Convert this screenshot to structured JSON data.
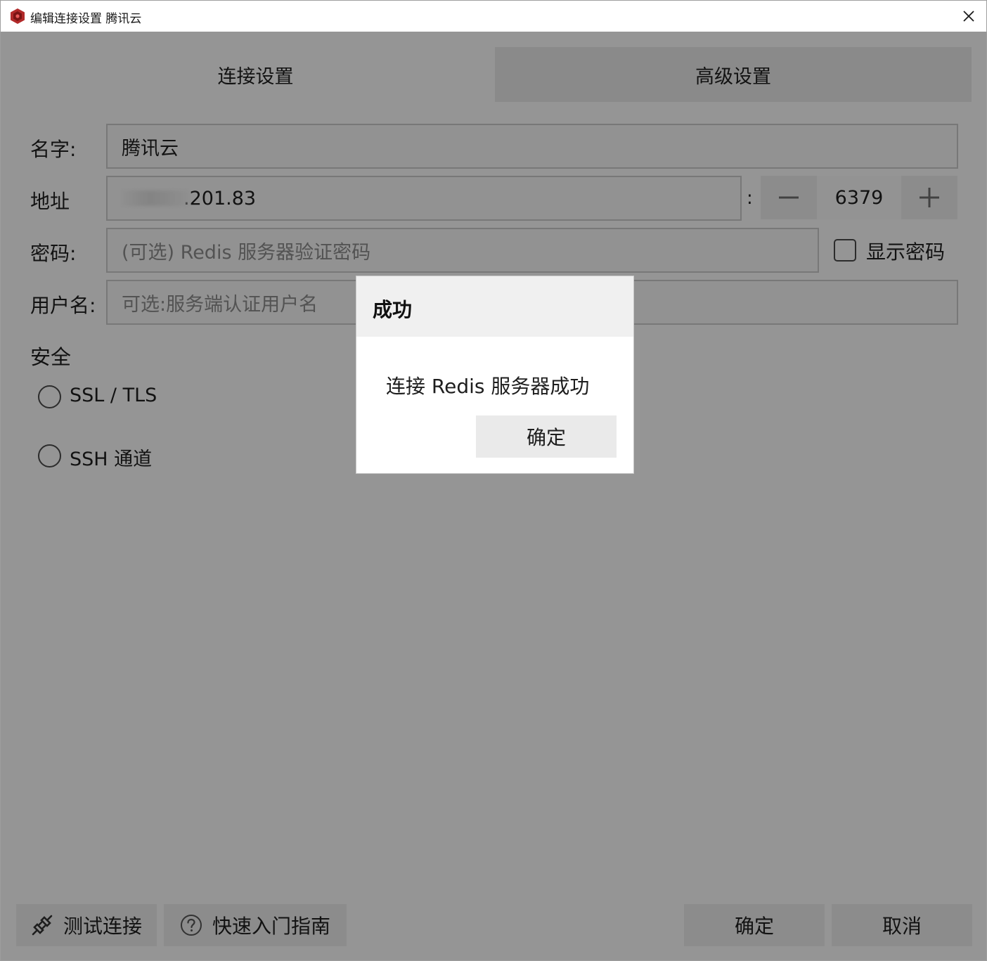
{
  "window": {
    "title": "编辑连接设置 腾讯云"
  },
  "tabs": {
    "connection": "连接设置",
    "advanced": "高级设置"
  },
  "form": {
    "name": {
      "label": "名字:",
      "value": "腾讯云"
    },
    "address": {
      "label": "地址",
      "value": ".201.83",
      "separator": ":"
    },
    "port": {
      "value": "6379"
    },
    "password": {
      "label": "密码:",
      "placeholder": "(可选) Redis 服务器验证密码",
      "show_password_label": "显示密码"
    },
    "username": {
      "label": "用户名:",
      "placeholder": "可选:服务端认证用户名"
    }
  },
  "security": {
    "title": "安全",
    "ssl_label": "SSL / TLS",
    "ssh_label": "SSH 通道"
  },
  "footer": {
    "test_connection": "测试连接",
    "quick_start": "快速入门指南",
    "ok": "确定",
    "cancel": "取消"
  },
  "dialog": {
    "title": "成功",
    "message": "连接 Redis 服务器成功",
    "ok": "确定"
  },
  "colors": {
    "app_icon": "#b22a2a",
    "overlay": "rgba(0,0,0,0.40)"
  },
  "icons": {
    "app": "redis-logo-icon",
    "close": "close-icon",
    "minus": "minus-icon",
    "plus": "plus-icon",
    "test": "plug-icon",
    "help": "question-circle-icon"
  }
}
